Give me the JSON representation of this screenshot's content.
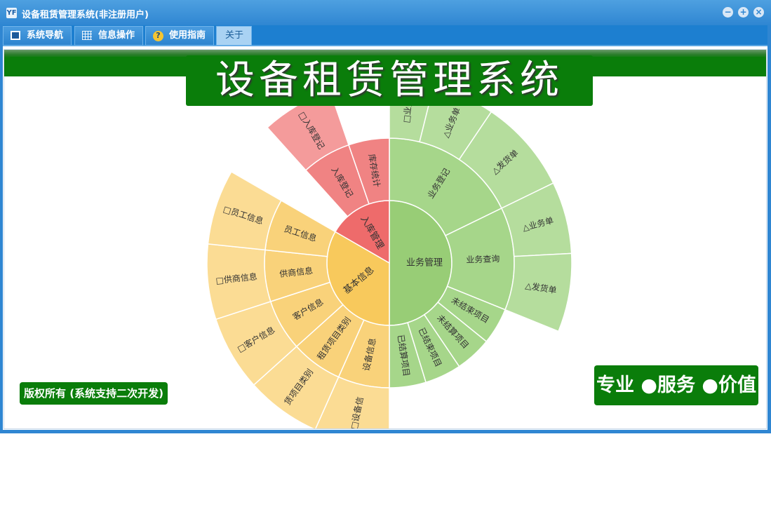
{
  "window": {
    "title": "设备租赁管理系统(非注册用户)",
    "app_icon": "YF"
  },
  "window_buttons": [
    {
      "name": "minimize-button",
      "glyph": "−"
    },
    {
      "name": "maximize-button",
      "glyph": "+"
    },
    {
      "name": "close-button",
      "glyph": "×"
    }
  ],
  "menu": {
    "items": [
      {
        "label": "系统导航",
        "icon": "screen-icon"
      },
      {
        "label": "信息操作",
        "icon": "grid-icon"
      },
      {
        "label": "使用指南",
        "icon": "help-icon"
      },
      {
        "label": "关于",
        "icon": ""
      }
    ],
    "active_index": 3
  },
  "banner": {
    "title": "设备租赁管理系统"
  },
  "footer": {
    "copyright": "版权所有 (系统支持二次开发)",
    "slogan": "专业 ●服务 ●价值"
  },
  "colors": {
    "titlebar": "#2f86d2",
    "brand_green": "#0a7d0a",
    "business": "#9bcf79",
    "business_outer": "#b5dd9d",
    "warehouse": "#ef6f6f",
    "warehouse_outer": "#f59a9a",
    "basic": "#f8c95c",
    "basic_outer": "#fad98d"
  },
  "sunburst": [
    {
      "name": "业务管理",
      "color": "#98cd76",
      "children": [
        {
          "name": "业务登记",
          "color": "#a6d68a",
          "children": [
            {
              "name": "□业务",
              "color": "#b5dd9d"
            },
            {
              "name": "△业务单",
              "color": "#b5dd9d"
            },
            {
              "name": "△发货单",
              "color": "#b5dd9d"
            }
          ]
        },
        {
          "name": "业务查询",
          "color": "#a6d68a",
          "children": [
            {
              "name": "△业务单",
              "color": "#b5dd9d"
            },
            {
              "name": "△发货单",
              "color": "#b5dd9d"
            }
          ]
        },
        {
          "name": "未结束项目",
          "color": "#a6d68a"
        },
        {
          "name": "未结算项目",
          "color": "#a6d68a"
        },
        {
          "name": "已结束项目",
          "color": "#a6d68a"
        },
        {
          "name": "已结算项目",
          "color": "#a6d68a"
        }
      ]
    },
    {
      "name": "基本信息",
      "color": "#f8c95c",
      "children": [
        {
          "name": "设备信息",
          "color": "#f9d27a",
          "children": [
            {
              "name": "□设备信",
              "color": "#fbdc94"
            }
          ]
        },
        {
          "name": "租赁项目类别",
          "color": "#f9d27a",
          "children": [
            {
              "name": "赁项目类别",
              "color": "#fbdc94"
            }
          ]
        },
        {
          "name": "客户信息",
          "color": "#f9d27a",
          "children": [
            {
              "name": "□客户信息",
              "color": "#fbdc94"
            }
          ]
        },
        {
          "name": "供商信息",
          "color": "#f9d27a",
          "children": [
            {
              "name": "□供商信息",
              "color": "#fbdc94"
            }
          ]
        },
        {
          "name": "员工信息",
          "color": "#f9d27a",
          "children": [
            {
              "name": "□员工信息",
              "color": "#fbdc94"
            }
          ]
        }
      ]
    },
    {
      "name": "入库管理",
      "color": "#ee6b6b",
      "children": [
        {
          "name": "入库登记",
          "color": "#f08383",
          "children": [
            {
              "name": "□入库登记",
              "color": "#f49b9b"
            }
          ]
        },
        {
          "name": "库存统计",
          "color": "#f08383"
        }
      ]
    }
  ]
}
